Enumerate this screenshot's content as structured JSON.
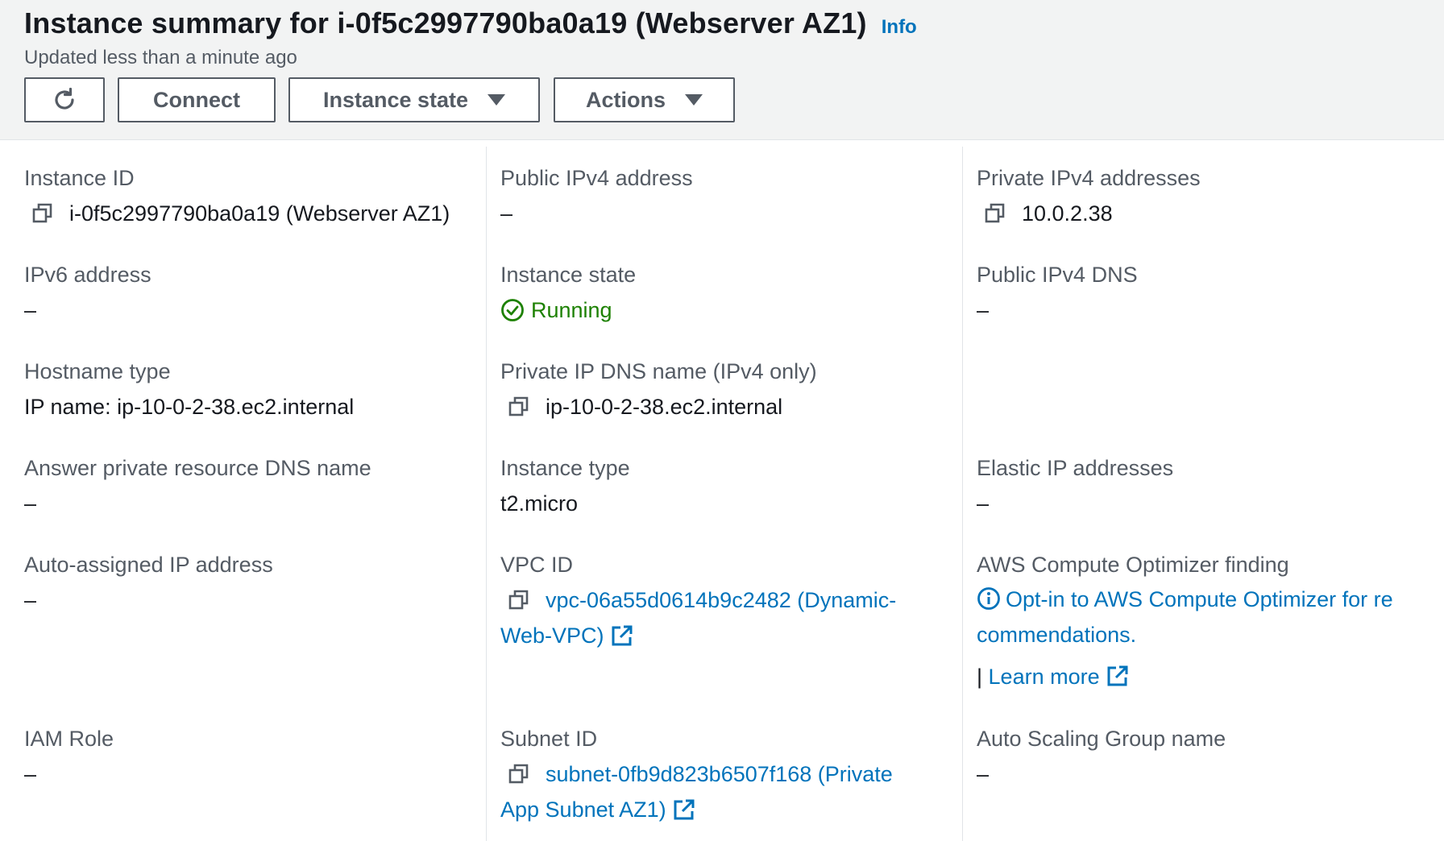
{
  "header": {
    "title": "Instance summary for i-0f5c2997790ba0a19 (Webserver AZ1)",
    "info_link": "Info",
    "updated": "Updated less than a minute ago",
    "buttons": {
      "refresh_icon": "refresh-icon",
      "connect": "Connect",
      "instance_state": "Instance state",
      "actions": "Actions"
    }
  },
  "col1": {
    "instance_id": {
      "label": "Instance ID",
      "value": "i-0f5c2997790ba0a19 (Webserver AZ1)"
    },
    "ipv6": {
      "label": "IPv6 address",
      "value": "–"
    },
    "hostname_type": {
      "label": "Hostname type",
      "value": "IP name: ip-10-0-2-38.ec2.internal"
    },
    "answer_dns": {
      "label": "Answer private resource DNS name",
      "value": "–"
    },
    "auto_ip": {
      "label": "Auto-assigned IP address",
      "value": "–"
    },
    "iam_role": {
      "label": "IAM Role",
      "value": "–"
    }
  },
  "col2": {
    "public_ipv4": {
      "label": "Public IPv4 address",
      "value": "–"
    },
    "instance_state": {
      "label": "Instance state",
      "value": "Running",
      "status_color": "#1d8102"
    },
    "private_dns": {
      "label": "Private IP DNS name (IPv4 only)",
      "value": "ip-10-0-2-38.ec2.internal"
    },
    "instance_type": {
      "label": "Instance type",
      "value": "t2.micro"
    },
    "vpc_id": {
      "label": "VPC ID",
      "value_line1": "vpc-06a55d0614b9c2482 (Dynamic-",
      "value_line2": "Web-VPC)"
    },
    "subnet_id": {
      "label": "Subnet ID",
      "value_line1": "subnet-0fb9d823b6507f168 (Private",
      "value_line2": "App Subnet AZ1)"
    }
  },
  "col3": {
    "private_ipv4": {
      "label": "Private IPv4 addresses",
      "value": "10.0.2.38"
    },
    "public_dns": {
      "label": "Public IPv4 DNS",
      "value": "–"
    },
    "elastic_ip": {
      "label": "Elastic IP addresses",
      "value": "–"
    },
    "optimizer": {
      "label": "AWS Compute Optimizer finding",
      "value_line1": "Opt-in to AWS Compute Optimizer for re",
      "value_line2": "commendations.",
      "separator": "|",
      "learn_more": "Learn more"
    },
    "asg": {
      "label": "Auto Scaling Group name",
      "value": "–"
    }
  },
  "colors": {
    "link": "#0073bb",
    "label": "#545b64",
    "text": "#16191f",
    "success": "#1d8102",
    "header_bg": "#f2f3f3"
  }
}
